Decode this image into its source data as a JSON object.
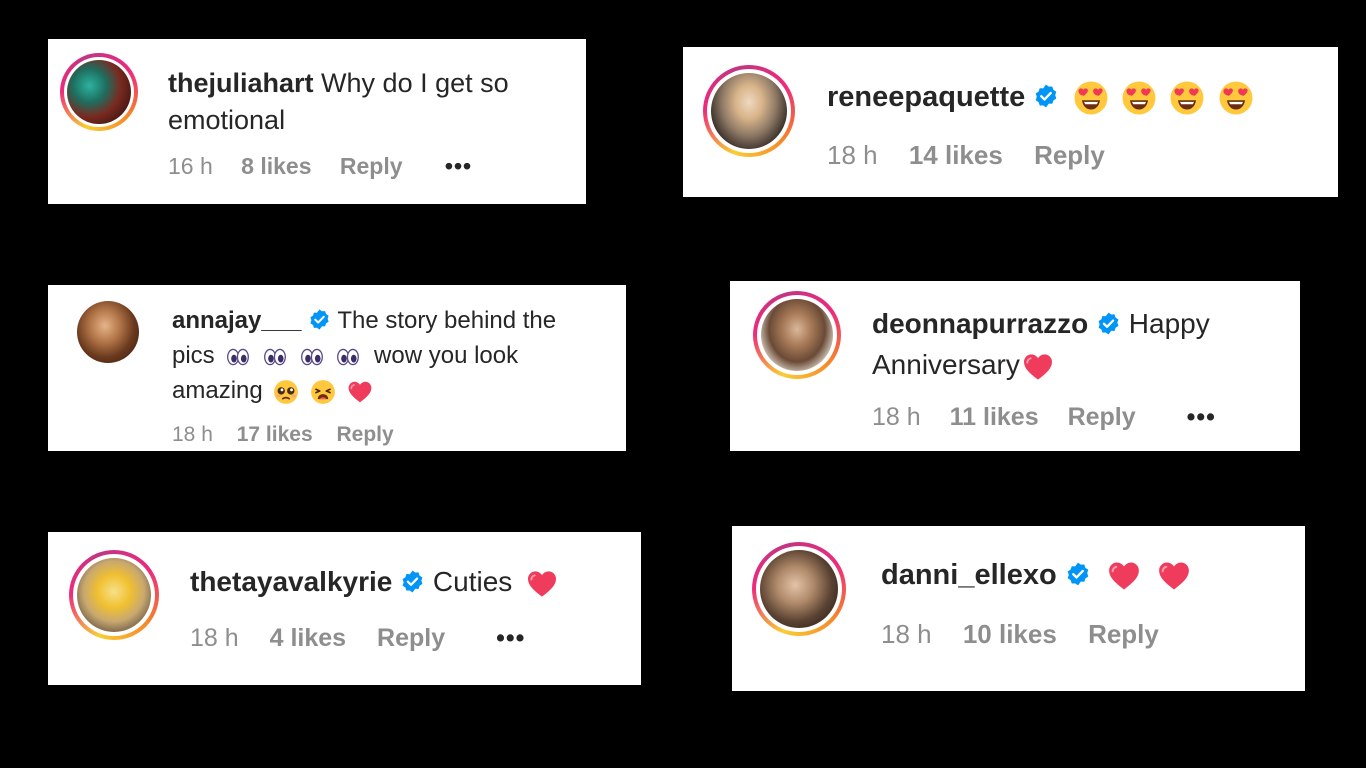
{
  "comments": [
    {
      "username": "thejuliahart",
      "text_line1": "Why do I get so",
      "text_line2": "emotional",
      "time": "16 h",
      "likes": "8 likes",
      "reply": "Reply",
      "more": "•••"
    },
    {
      "username": "reneepaquette",
      "time": "18 h",
      "likes": "14 likes",
      "reply": "Reply"
    },
    {
      "username": "annajay___",
      "text_line1": "The story behind the",
      "text_line2a": "pics",
      "text_line2b": "wow you look",
      "text_line3": "amazing",
      "time": "18 h",
      "likes": "17 likes",
      "reply": "Reply"
    },
    {
      "username": "deonnapurrazzo",
      "text_line1": "Happy",
      "text_line2": "Anniversary",
      "time": "18 h",
      "likes": "11 likes",
      "reply": "Reply",
      "more": "•••"
    },
    {
      "username": "thetayavalkyrie",
      "text_line1": "Cuties",
      "time": "18 h",
      "likes": "4 likes",
      "reply": "Reply",
      "more": "•••"
    },
    {
      "username": "danni_ellexo",
      "time": "18 h",
      "likes": "10 likes",
      "reply": "Reply"
    }
  ],
  "colors": {
    "background": "#000000",
    "card": "#ffffff",
    "text": "#262626",
    "meta": "#8e8e8e",
    "verified": "#0095f6",
    "heart": "#e8304a"
  },
  "icons": [
    "verified-badge-icon",
    "heart-eyes-emoji",
    "eyes-emoji",
    "pleading-face-emoji",
    "weary-face-emoji",
    "red-heart-emoji",
    "more-options-icon"
  ]
}
